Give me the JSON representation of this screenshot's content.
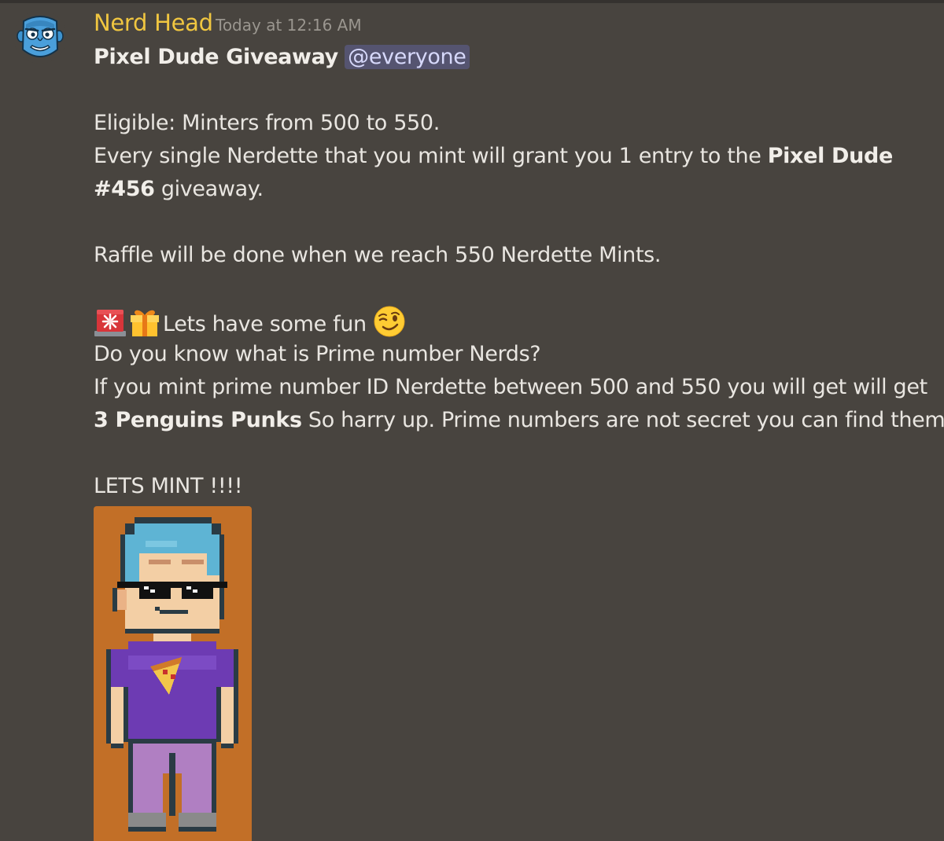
{
  "message": {
    "author": "Nerd Head",
    "timestamp": "Today at 12:16 AM",
    "title": "Pixel Dude Giveaway",
    "mention": "@everyone",
    "eligible": "Eligible: Minters from 500 to 550.",
    "entry_prefix": "Every single Nerdette that you mint will grant you 1 entry to the ",
    "entry_bold_1": "Pixel Dude",
    "entry_bold_2": "#456",
    "entry_suffix": " giveaway.",
    "raffle": "Raffle will be done when we reach 550 Nerdette Mints.",
    "fun": "Lets have some fun",
    "question": "Do you know what is Prime number Nerds?",
    "prime_line": "If you mint prime number ID Nerdette between 500 and 550 you will get will get",
    "prize_bold": "3 Penguins Punks",
    "prize_rest": " So harry up. Prime numbers are not secret you can find them.",
    "lets_mint": "LETS MINT !!!!"
  },
  "icons": {
    "avatar": "nerd-head-avatar",
    "emoji_1": "rotating-light-emoji",
    "emoji_2": "wrapped-gift-emoji",
    "emoji_3": "winking-face-emoji"
  },
  "colors": {
    "background": "#48443f",
    "author": "#f0c640",
    "mention_bg": "#555470",
    "attachment_bg": "#c26f27"
  }
}
